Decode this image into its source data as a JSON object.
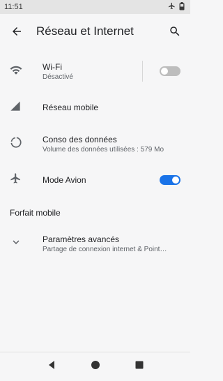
{
  "status_bar": {
    "time": "11:51",
    "icons": [
      "airplane-icon",
      "battery-icon"
    ]
  },
  "app_bar": {
    "title": "Réseau et Internet",
    "back_icon": "arrow-back-icon",
    "search_icon": "search-icon"
  },
  "items": [
    {
      "icon": "wifi-icon",
      "primary": "Wi-Fi",
      "secondary": "Désactivé",
      "toggle": "off"
    },
    {
      "icon": "mobile-signal-icon",
      "primary": "Réseau mobile"
    },
    {
      "icon": "data-usage-icon",
      "primary": "Conso des données",
      "secondary": "Volume des données utilisées : 579 Mo"
    },
    {
      "icon": "airplane-icon",
      "primary": "Mode Avion",
      "toggle": "on"
    }
  ],
  "section": {
    "title": "Forfait mobile"
  },
  "advanced": {
    "icon": "chevron-down-icon",
    "primary": "Paramètres avancés",
    "secondary": "Partage de connexion internet & Point…"
  },
  "nav_bar": {
    "back": "nav-back-icon",
    "home": "nav-home-icon",
    "recents": "nav-recents-icon"
  },
  "colors": {
    "accent": "#1a73e8",
    "toggle_off": "#bdbdbd",
    "icon": "#5f6368"
  }
}
